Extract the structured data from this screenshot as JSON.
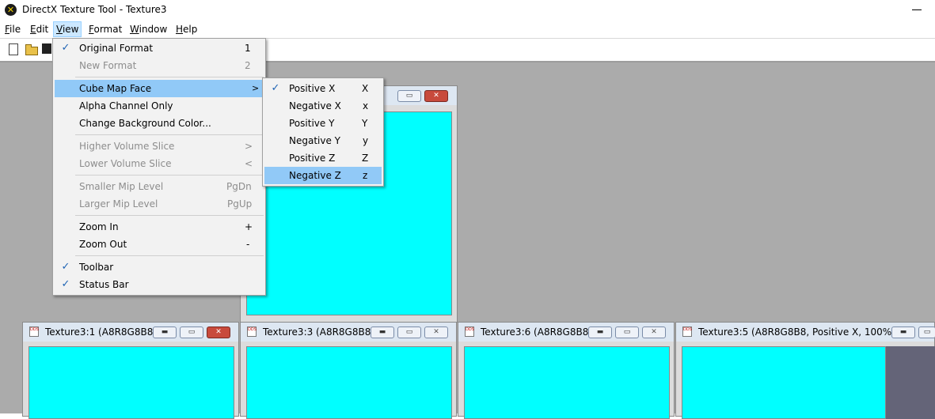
{
  "window": {
    "title": "DirectX Texture Tool - Texture3"
  },
  "menubar": [
    {
      "label": "File",
      "ul": "F",
      "rest": "ile"
    },
    {
      "label": "Edit",
      "ul": "E",
      "rest": "dit"
    },
    {
      "label": "View",
      "ul": "V",
      "rest": "iew"
    },
    {
      "label": "Format",
      "ul": "F",
      "rest": "ormat"
    },
    {
      "label": "Window",
      "ul": "W",
      "rest": "indow"
    },
    {
      "label": "Help",
      "ul": "H",
      "rest": "elp"
    }
  ],
  "view_menu": {
    "items": [
      {
        "label": "Original Format",
        "shortcut": "1",
        "checked": true,
        "enabled": true
      },
      {
        "label": "New Format",
        "shortcut": "2",
        "checked": false,
        "enabled": false
      },
      {
        "label": "Cube Map Face",
        "shortcut": ">",
        "checked": false,
        "enabled": true,
        "submenu": true
      },
      {
        "label": "Alpha Channel Only",
        "shortcut": "",
        "checked": false,
        "enabled": true
      },
      {
        "label": "Change Background Color...",
        "shortcut": "",
        "checked": false,
        "enabled": true
      },
      {
        "label": "Higher Volume Slice",
        "shortcut": ">",
        "checked": false,
        "enabled": false
      },
      {
        "label": "Lower Volume Slice",
        "shortcut": "<",
        "checked": false,
        "enabled": false
      },
      {
        "label": "Smaller Mip Level",
        "shortcut": "PgDn",
        "checked": false,
        "enabled": false
      },
      {
        "label": "Larger Mip Level",
        "shortcut": "PgUp",
        "checked": false,
        "enabled": false
      },
      {
        "label": "Zoom In",
        "shortcut": "+",
        "checked": false,
        "enabled": true
      },
      {
        "label": "Zoom Out",
        "shortcut": "-",
        "checked": false,
        "enabled": true
      },
      {
        "label": "Toolbar",
        "shortcut": "",
        "checked": true,
        "enabled": true
      },
      {
        "label": "Status Bar",
        "shortcut": "",
        "checked": true,
        "enabled": true
      }
    ]
  },
  "cube_face_menu": {
    "items": [
      {
        "label": "Positive X",
        "shortcut": "X",
        "checked": true
      },
      {
        "label": "Negative X",
        "shortcut": "x",
        "checked": false
      },
      {
        "label": "Positive Y",
        "shortcut": "Y",
        "checked": false
      },
      {
        "label": "Negative Y",
        "shortcut": "y",
        "checked": false
      },
      {
        "label": "Positive Z",
        "shortcut": "Z",
        "checked": false
      },
      {
        "label": "Negative Z",
        "shortcut": "z",
        "checked": false
      }
    ]
  },
  "child_windows": [
    {
      "title": "Texture3:1 (A8R8G8B8..."
    },
    {
      "title": "Texture3:3 (A8R8G8B8..."
    },
    {
      "title": "Texture3:6 (A8R8G8B8..."
    },
    {
      "title": "Texture3:5 (A8R8G8B8, Positive X, 100%)"
    }
  ],
  "icon_text": {
    "dds": "DDS"
  },
  "colors": {
    "texture_fill": "#00ffff",
    "mdi_background": "#ababab",
    "highlight": "#91c9f7"
  }
}
